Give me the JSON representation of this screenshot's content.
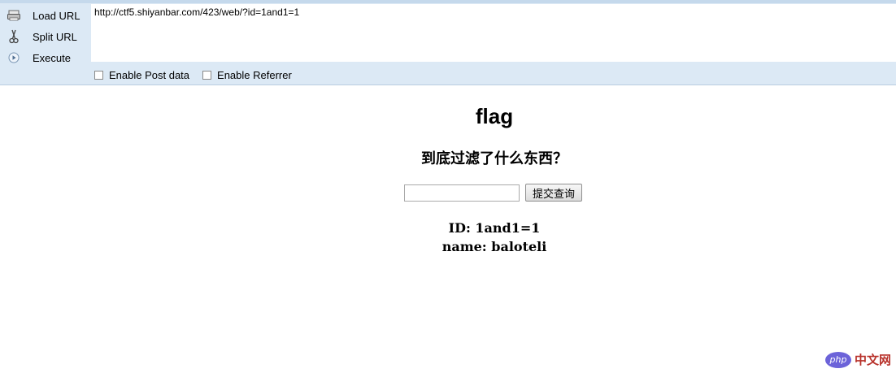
{
  "toolbar": {
    "load_url": "Load URL",
    "split_url": "Split URL",
    "execute": "Execute",
    "url_value": "http://ctf5.shiyanbar.com/423/web/?id=1and1=1",
    "enable_post": "Enable Post data",
    "enable_referrer": "Enable Referrer"
  },
  "page": {
    "title": "flag",
    "subtitle": "到底过滤了什么东西？",
    "input_value": "",
    "submit_label": "提交查询",
    "result_id": "ID: 1and1=1",
    "result_name": "name: baloteli"
  },
  "watermark": {
    "logo": "php",
    "text": "中文网"
  },
  "colors": {
    "toolbar_bg": "#dce9f5",
    "watermark_logo": "#6c63d9",
    "watermark_text": "#b8322b"
  }
}
